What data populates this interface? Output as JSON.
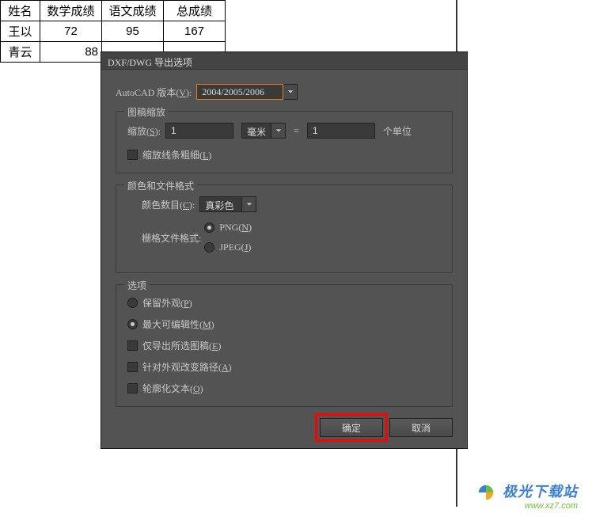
{
  "table": {
    "headers": [
      "姓名",
      "数学成绩",
      "语文成绩",
      "总成绩"
    ],
    "rows": [
      [
        "王以",
        "72",
        "95",
        "167"
      ],
      [
        "青云",
        "88",
        "",
        ""
      ]
    ]
  },
  "dialog": {
    "title": "DXF/DWG 导出选项",
    "version_label": "AutoCAD 版本(",
    "version_hotkey": "V",
    "version_label_end": "):",
    "version_value": "2004/2005/2006",
    "group_scale": {
      "legend": "图稿缩放",
      "scale_label": "缩放(",
      "scale_hotkey": "S",
      "scale_label_end": "):",
      "scale_value": "1",
      "unit": "毫米",
      "equals": "=",
      "to_value": "1",
      "to_unit": "个单位",
      "scale_lines": "缩放线条粗细(",
      "scale_lines_hotkey": "L",
      "scale_lines_end": ")"
    },
    "group_color": {
      "legend": "颜色和文件格式",
      "color_count_label": "颜色数目(",
      "color_count_hotkey": "C",
      "color_count_end": "):",
      "color_count_value": "真彩色",
      "raster_label": "栅格文件格式:",
      "png": "PNG(",
      "png_hotkey": "N",
      "png_end": ")",
      "jpeg": "JPEG(",
      "jpeg_hotkey": "J",
      "jpeg_end": ")"
    },
    "group_options": {
      "legend": "选项",
      "preserve_appearance": "保留外观(",
      "preserve_appearance_hotkey": "P",
      "preserve_appearance_end": ")",
      "max_editable": "最大可编辑性(",
      "max_editable_hotkey": "M",
      "max_editable_end": ")",
      "export_selected": "仅导出所选图稿(",
      "export_selected_hotkey": "E",
      "export_selected_end": ")",
      "alter_paths": "针对外观改变路径(",
      "alter_paths_hotkey": "A",
      "alter_paths_end": ")",
      "outline_text": "轮廓化文本(",
      "outline_text_hotkey": "O",
      "outline_text_end": ")"
    },
    "ok": "确定",
    "cancel": "取消"
  },
  "watermark": {
    "text": "极光下载站",
    "url": "www.xz7.com"
  }
}
